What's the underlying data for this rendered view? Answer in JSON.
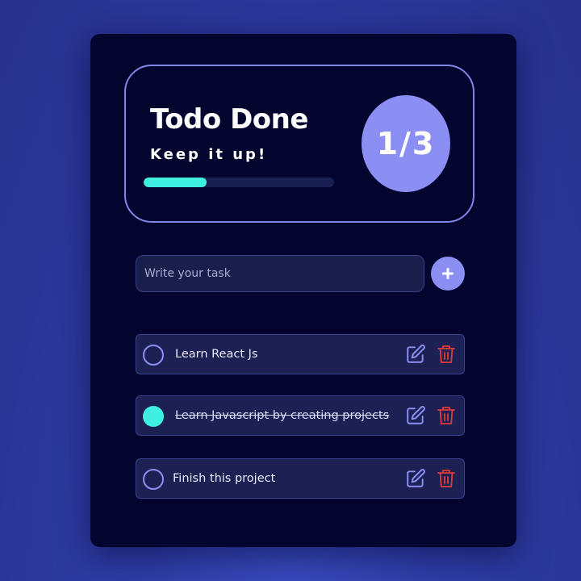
{
  "summary": {
    "title": "Todo Done",
    "subtitle": "Keep it up!",
    "count_text": "1/3",
    "completed": 1,
    "total": 3,
    "progress_fraction": 0.33
  },
  "input": {
    "placeholder": "Write your task",
    "value": ""
  },
  "add_button": {
    "icon": "plus-icon"
  },
  "todos": [
    {
      "text": "Learn React Js",
      "done": false
    },
    {
      "text": "Learn Javascript by creating projects",
      "done": true
    },
    {
      "text": "Finish this project",
      "done": false
    }
  ],
  "icons": {
    "check": "circle-check-icon",
    "edit": "edit-icon",
    "delete": "trash-icon"
  },
  "colors": {
    "background": "#2f3da6",
    "card": "#03052e",
    "accent": "#8b8ff3",
    "progress": "#3ff0e0",
    "done_check": "#3ff0e0",
    "delete": "#e03a3a",
    "item_bg": "#1c2052"
  }
}
